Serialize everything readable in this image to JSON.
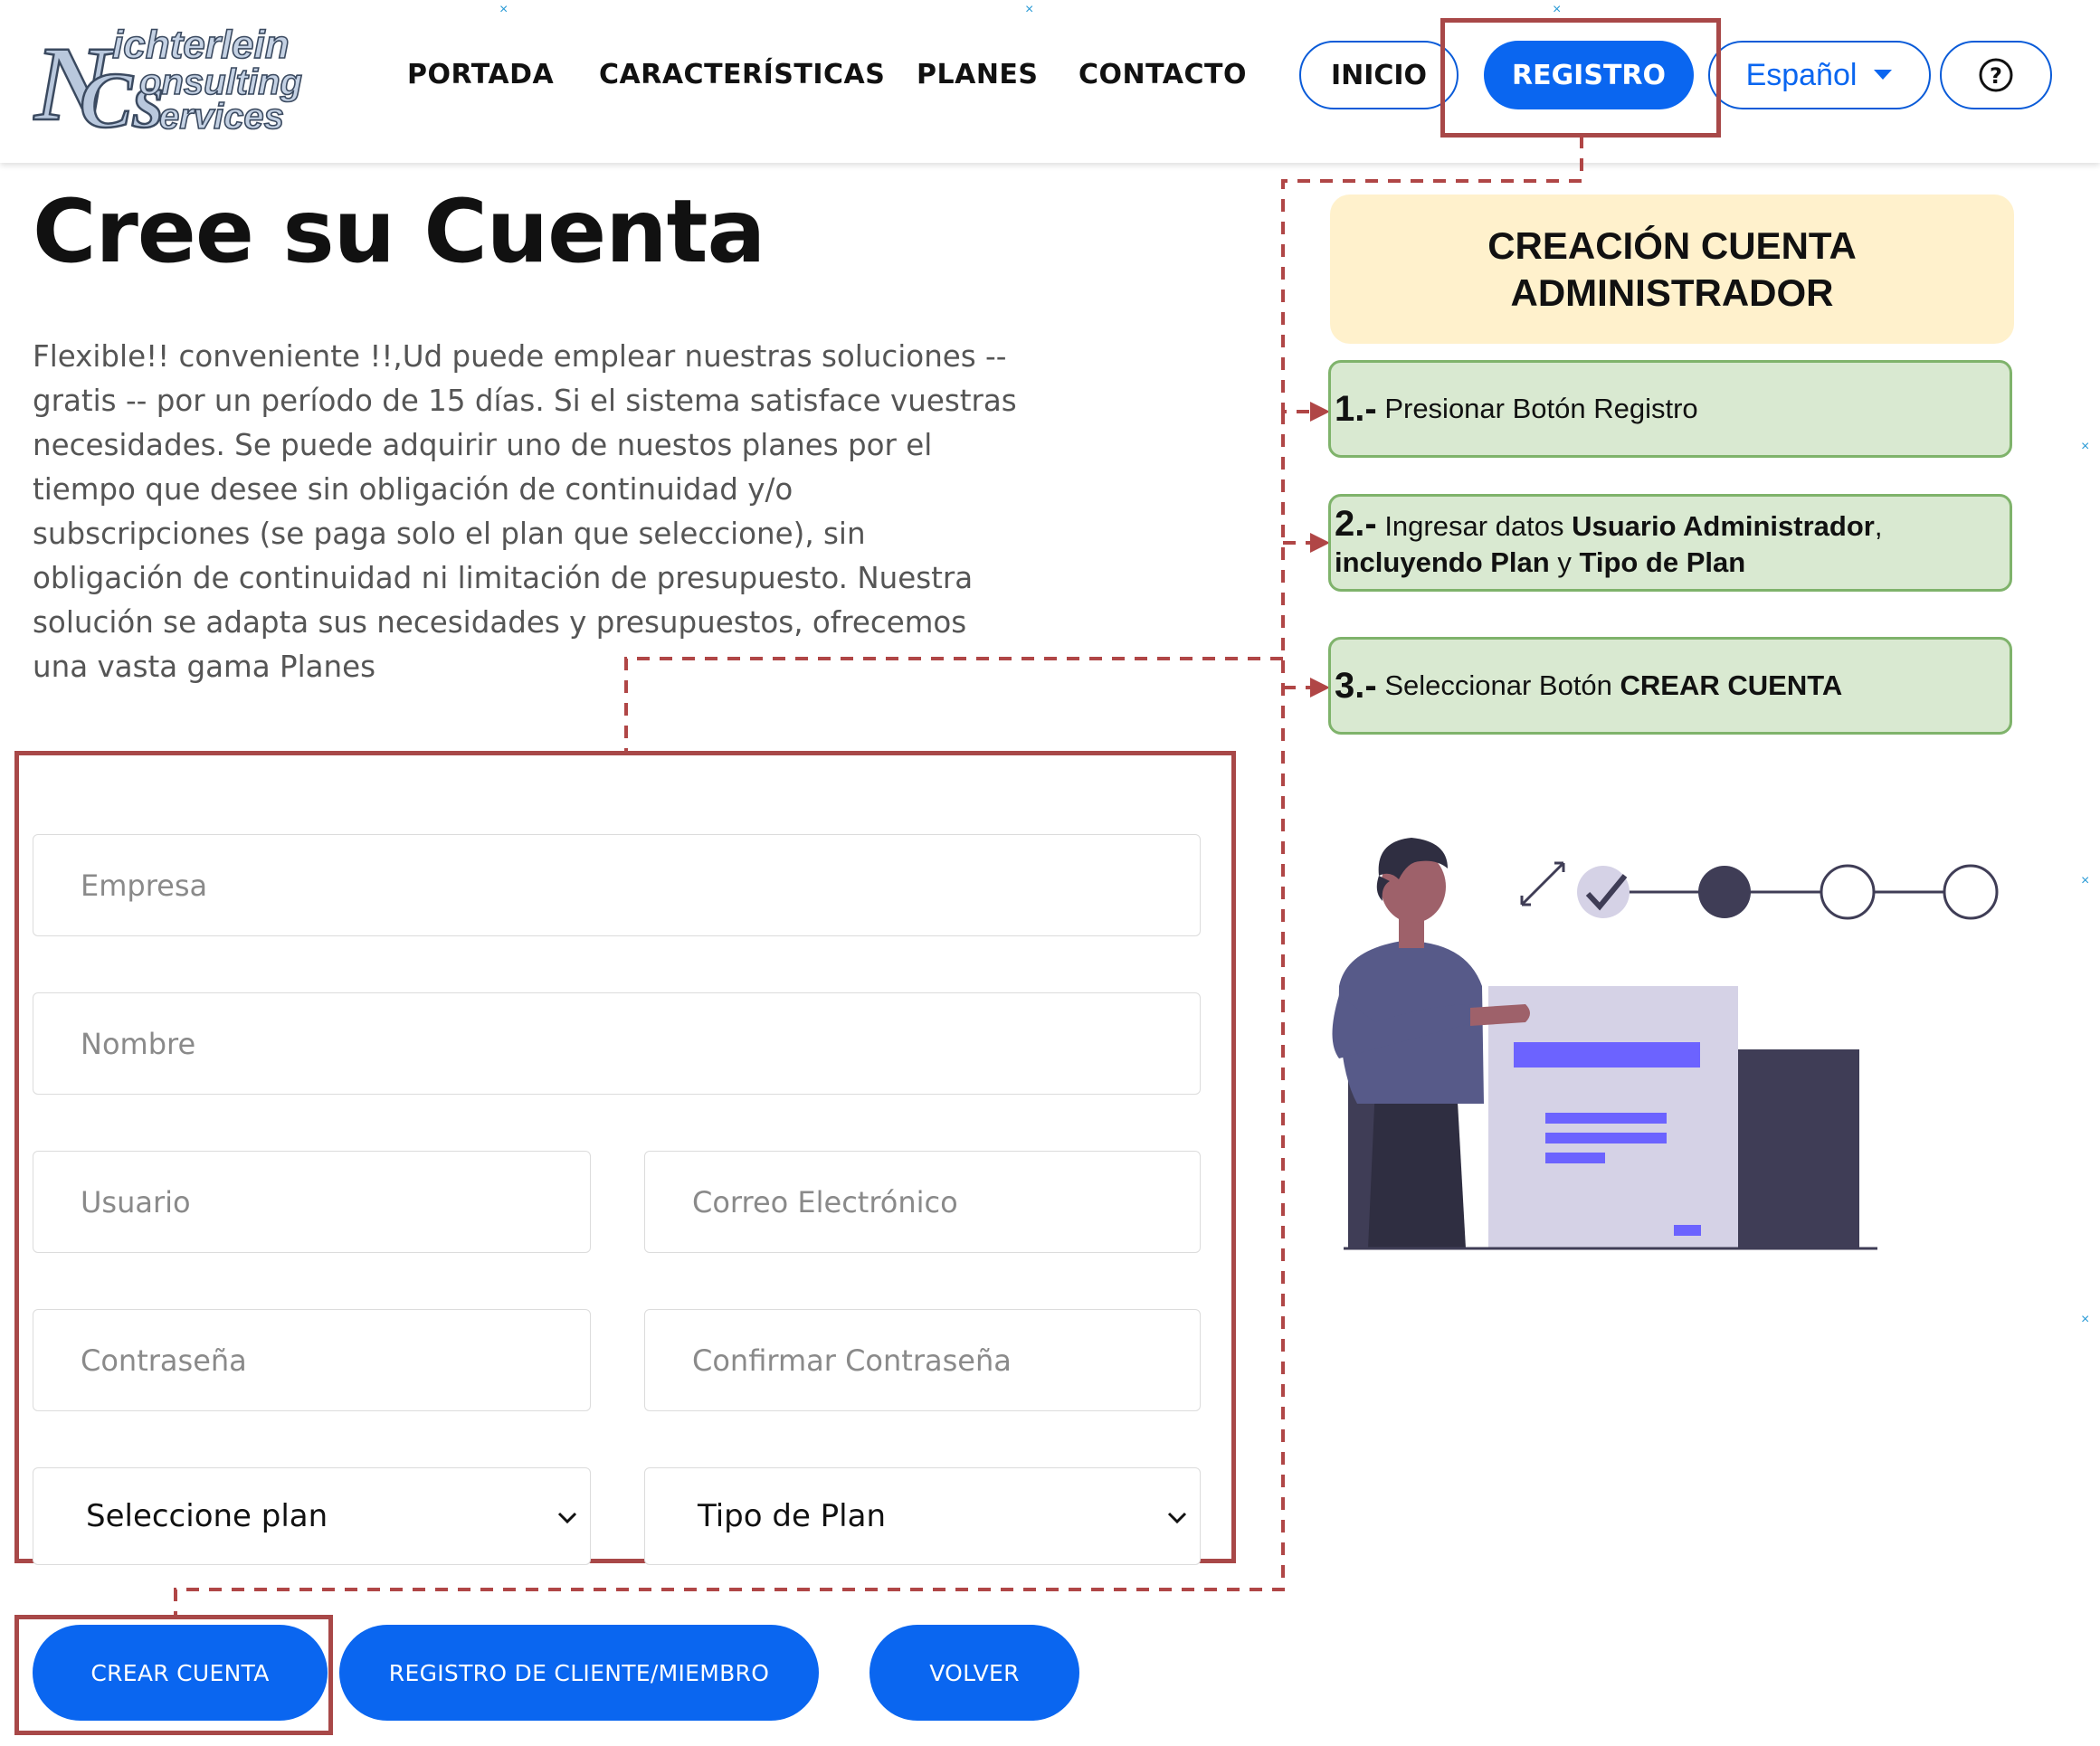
{
  "header": {
    "logo": {
      "line1": "ichterlein",
      "line2": "onsulting",
      "line3": "ervices",
      "letters": "NCs"
    },
    "nav": [
      "PORTADA",
      "CARACTERÍSTICAS",
      "PLANES",
      "CONTACTO"
    ],
    "inicio_label": "INICIO",
    "registro_label": "REGISTRO",
    "language_label": "Español",
    "help_symbol": "?"
  },
  "main": {
    "title": "Cree su Cuenta",
    "intro_lines": [
      "Flexible!! conveniente !!,Ud puede emplear nuestras soluciones --",
      "gratis -- por un período de 15 días. Si el sistema satisface vuestras",
      "necesidades. Se puede adquirir uno de nuestos planes por el",
      "tiempo que desee sin obligación de continuidad y/o",
      "subscripciones (se paga solo el plan que seleccione), sin",
      "obligación de continuidad ni limitación de presupuesto. Nuestra",
      "solución se adapta sus necesidades y presupuestos, ofrecemos",
      "una vasta gama Planes"
    ]
  },
  "form": {
    "empresa_placeholder": "Empresa",
    "nombre_placeholder": "Nombre",
    "usuario_placeholder": "Usuario",
    "correo_placeholder": "Correo Electrónico",
    "contrasena_placeholder": "Contraseña",
    "confirmar_placeholder": "Confirmar Contraseña",
    "plan_select": "Seleccione plan",
    "tipo_plan_select": "Tipo de Plan"
  },
  "actions": {
    "crear_cuenta": "CREAR CUENTA",
    "registro_cliente": "REGISTRO DE CLIENTE/MIEMBRO",
    "volver": "VOLVER"
  },
  "guide": {
    "title_line1": "CREACIÓN CUENTA",
    "title_line2": "ADMINISTRADOR",
    "step1": {
      "num": "1.-",
      "text": "Presionar Botón Registro"
    },
    "step2": {
      "num": "2.-",
      "pre": "Ingresar datos ",
      "b1": "Usuario Administrador",
      "post1": ",",
      "b2": "incluyendo Plan",
      "mid": " y ",
      "b3": "Tipo de Plan"
    },
    "step3": {
      "num": "3.-",
      "pre": "Seleccionar Botón ",
      "b1": "CREAR CUENTA"
    }
  },
  "colors": {
    "primary": "#0a66f0",
    "annotation_red": "#a84848",
    "guide_title_bg": "#fff1cc",
    "step_bg": "#d9e9d1",
    "step_border": "#7fb36b",
    "illustration_purple": "#6c63ff",
    "illustration_dark": "#3f3d56"
  },
  "icons": {
    "language_caret": "caret-down-icon",
    "help": "question-circle-icon",
    "select_chevron": "chevron-down-icon"
  }
}
